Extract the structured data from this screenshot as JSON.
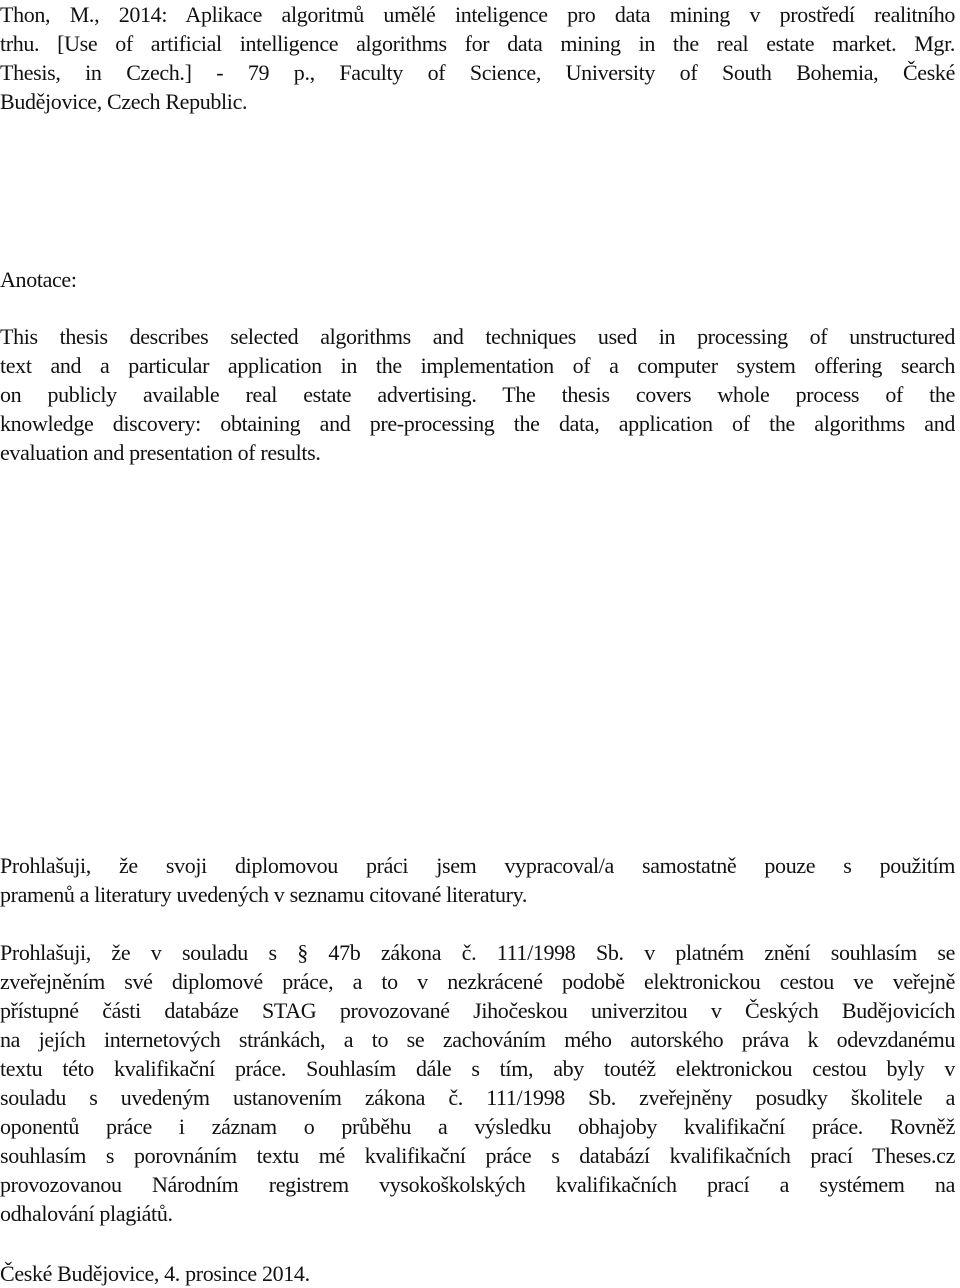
{
  "document": {
    "citation": {
      "lines": [
        "Thon, M., 2014: Aplikace algoritmů umělé inteligence pro data mining v prostředí realitního",
        "trhu. [Use of artificial intelligence algorithms for data mining in the real estate market. Mgr.",
        "Thesis, in Czech.] - 79 p., Faculty of Science, University of South Bohemia, České",
        "Budějovice, Czech Republic."
      ]
    },
    "annotation": {
      "heading": "Anotace:",
      "lines": [
        "This thesis describes selected algorithms and techniques used in processing of unstructured",
        "text and a particular application in the implementation of a computer system offering search",
        "on publicly available real estate advertising. The thesis covers whole process of the",
        "knowledge discovery: obtaining and pre-processing the data, application of the algorithms and",
        "evaluation and presentation of results."
      ]
    },
    "declaration_1": {
      "lines": [
        "Prohlašuji, že svoji diplomovou práci jsem vypracoval/a samostatně pouze s použitím",
        "pramenů a literatury uvedených v seznamu citované literatury."
      ]
    },
    "declaration_2": {
      "lines": [
        "Prohlašuji, že v souladu s § 47b zákona č. 111/1998 Sb. v platném znění souhlasím se",
        "zveřejněním své diplomové práce, a to v nezkrácené podobě elektronickou cestou ve veřejně",
        "přístupné části databáze STAG provozované Jihočeskou univerzitou v Českých Budějovicích",
        "na jejích internetových stránkách, a to se zachováním mého autorského práva k odevzdanému",
        "textu této kvalifikační práce. Souhlasím dále s tím, aby toutéž elektronickou cestou byly v",
        "souladu s uvedeným ustanovením zákona č. 111/1998 Sb. zveřejněny posudky školitele a",
        "oponentů práce i záznam o průběhu a výsledku obhajoby kvalifikační práce. Rovněž",
        "souhlasím s porovnáním textu mé kvalifikační práce s databází kvalifikačních prací Theses.cz",
        "provozovanou Národním registrem vysokoškolských kvalifikačních prací a systémem na",
        "odhalování plagiátů."
      ]
    },
    "place_date": "České Budějovice, 4. prosince 2014."
  }
}
